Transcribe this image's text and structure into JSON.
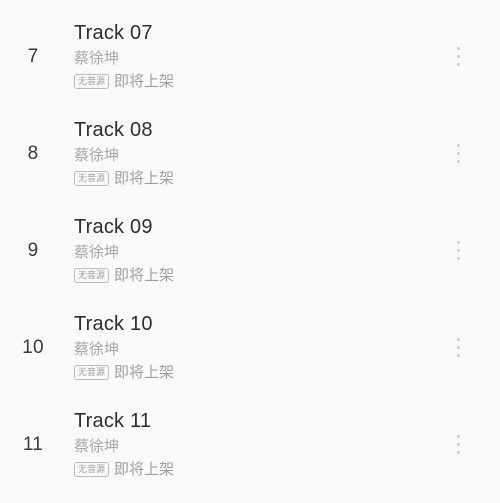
{
  "screen": {
    "name": "playlist-track-list",
    "background_color": "#fafafa"
  },
  "theme": {
    "title_color": "#2e2e2e",
    "index_color": "#3b3b3b",
    "secondary_text_color": "#a8a8a8",
    "badge_border_color": "#bdbdbd",
    "badge_text_color": "#9e9e9e",
    "menu_dot_color": "#cfcfcf"
  },
  "icons": {
    "overflow_menu": "more-vertical-icon"
  },
  "tracks": [
    {
      "index": "7",
      "title": "Track 07",
      "artist": "蔡徐坤",
      "badge": "无音源",
      "status": "即将上架"
    },
    {
      "index": "8",
      "title": "Track 08",
      "artist": "蔡徐坤",
      "badge": "无音源",
      "status": "即将上架"
    },
    {
      "index": "9",
      "title": "Track 09",
      "artist": "蔡徐坤",
      "badge": "无音源",
      "status": "即将上架"
    },
    {
      "index": "10",
      "title": "Track 10",
      "artist": "蔡徐坤",
      "badge": "无音源",
      "status": "即将上架"
    },
    {
      "index": "11",
      "title": "Track 11",
      "artist": "蔡徐坤",
      "badge": "无音源",
      "status": "即将上架"
    }
  ]
}
